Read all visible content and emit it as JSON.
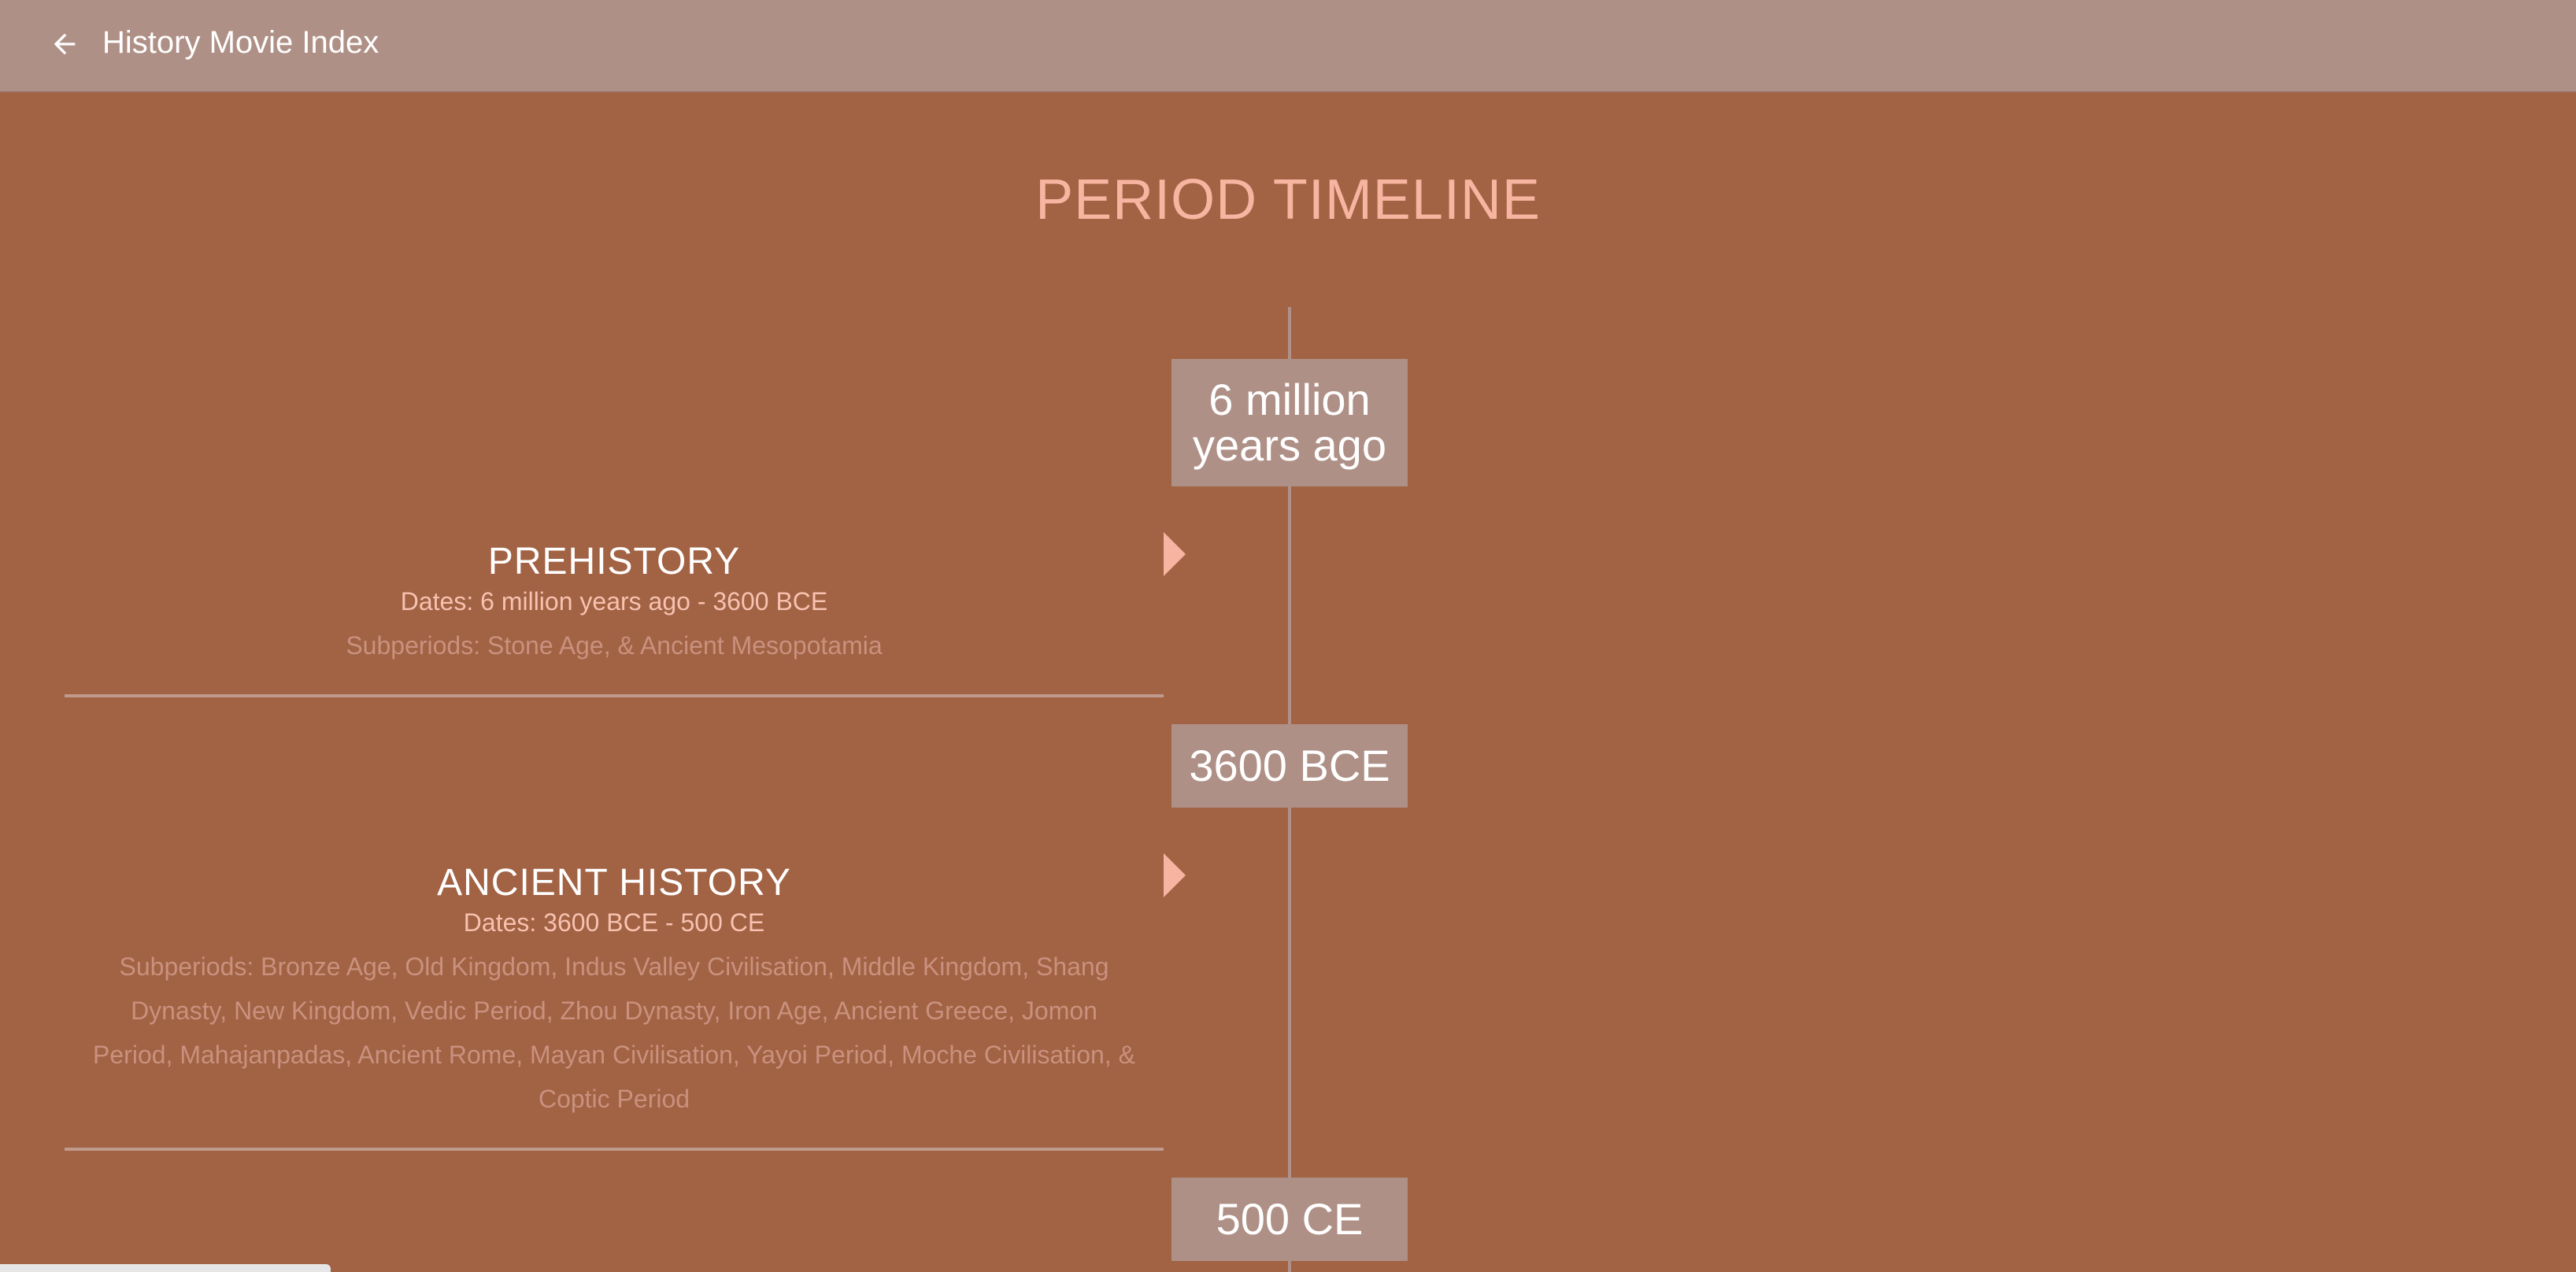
{
  "header": {
    "back_icon": "arrow-left-icon",
    "title": "History Movie Index"
  },
  "page": {
    "title": "PERIOD TIMELINE"
  },
  "timeline": {
    "markers": [
      {
        "label_line1": "6 million",
        "label_line2": "years ago"
      },
      {
        "label": "3600 BCE"
      },
      {
        "label": "500 CE"
      }
    ],
    "periods": [
      {
        "title": "PREHISTORY",
        "dates": "Dates: 6 million years ago - 3600 BCE",
        "subperiods": "Subperiods: Stone Age, & Ancient Mesopotamia"
      },
      {
        "title": "ANCIENT HISTORY",
        "dates": "Dates: 3600 BCE - 500 CE",
        "subperiods": "Subperiods: Bronze Age, Old Kingdom, Indus Valley Civilisation, Middle Kingdom, Shang Dynasty, New Kingdom, Vedic Period, Zhou Dynasty, Iron Age, Ancient Greece, Jomon Period, Mahajanpadas, Ancient Rome, Mayan Civilisation, Yayoi Period, Moche Civilisation, & Coptic Period"
      }
    ]
  },
  "colors": {
    "background": "#a26244",
    "header": "#af9086",
    "accent": "#f7b4a0",
    "marker": "#af9086"
  }
}
